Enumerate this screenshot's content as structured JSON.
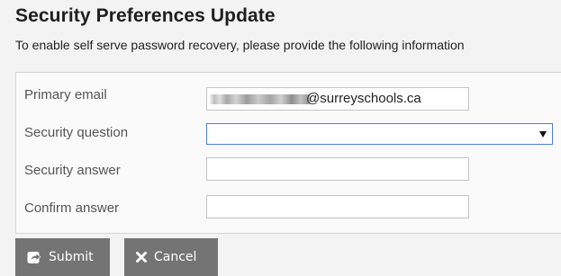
{
  "page": {
    "title": "Security Preferences Update",
    "subtitle": "To enable self serve password recovery, please provide the following information"
  },
  "form": {
    "primary_email": {
      "label": "Primary email",
      "value_visible_suffix": "@surreyschools.ca"
    },
    "security_question": {
      "label": "Security question",
      "selected_value": ""
    },
    "security_answer": {
      "label": "Security answer",
      "value": ""
    },
    "confirm_answer": {
      "label": "Confirm answer",
      "value": ""
    }
  },
  "actions": {
    "submit_label": "Submit",
    "submit_icon": "share-square-icon",
    "cancel_label": "Cancel",
    "cancel_icon": "x-icon"
  },
  "colors": {
    "page_background": "#f3f3f3",
    "button_background": "#747474",
    "select_focus_border": "#4a7fd6"
  }
}
